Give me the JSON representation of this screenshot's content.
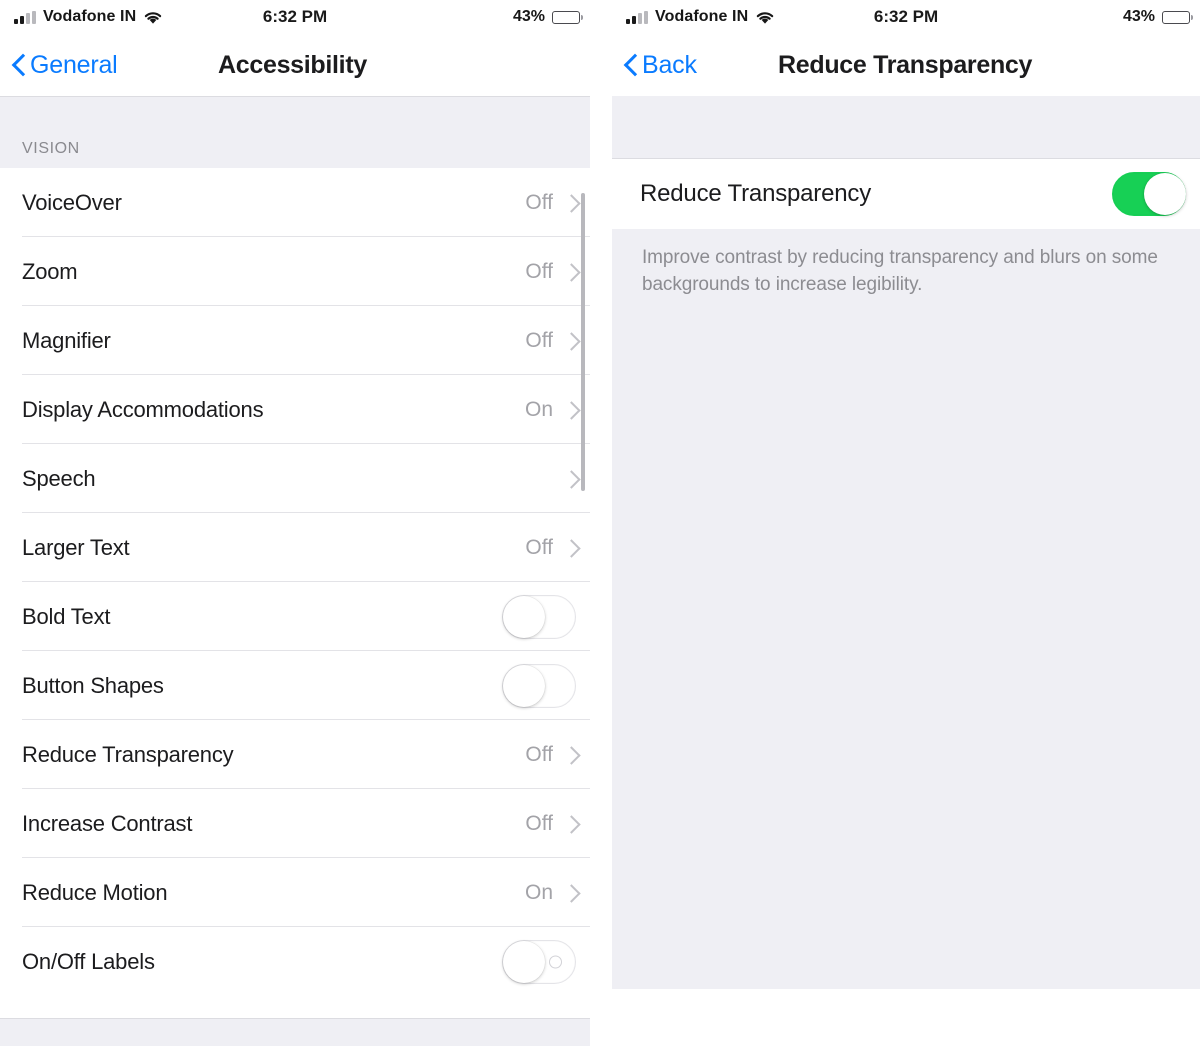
{
  "status_bar": {
    "carrier": "Vodafone IN",
    "wifi_icon": "wifi-icon",
    "time": "6:32 PM",
    "battery_percent": "43%",
    "battery_level": 43,
    "signal_bars_total": 4,
    "signal_bars_filled": 2
  },
  "left_screen": {
    "nav": {
      "back_label": "General",
      "back_icon": "chevron-left-icon",
      "title": "Accessibility"
    },
    "section_header": "VISION",
    "rows": [
      {
        "label": "VoiceOver",
        "value": "Off",
        "type": "disclosure"
      },
      {
        "label": "Zoom",
        "value": "Off",
        "type": "disclosure"
      },
      {
        "label": "Magnifier",
        "value": "Off",
        "type": "disclosure"
      },
      {
        "label": "Display Accommodations",
        "value": "On",
        "type": "disclosure"
      },
      {
        "label": "Speech",
        "value": "",
        "type": "disclosure"
      },
      {
        "label": "Larger Text",
        "value": "Off",
        "type": "disclosure"
      },
      {
        "label": "Bold Text",
        "value": "",
        "type": "switch",
        "switch_on": false,
        "off_label_mark": false
      },
      {
        "label": "Button Shapes",
        "value": "",
        "type": "switch",
        "switch_on": false,
        "off_label_mark": false
      },
      {
        "label": "Reduce Transparency",
        "value": "Off",
        "type": "disclosure"
      },
      {
        "label": "Increase Contrast",
        "value": "Off",
        "type": "disclosure"
      },
      {
        "label": "Reduce Motion",
        "value": "On",
        "type": "disclosure"
      },
      {
        "label": "On/Off Labels",
        "value": "",
        "type": "switch",
        "switch_on": false,
        "off_label_mark": true
      }
    ]
  },
  "right_screen": {
    "nav": {
      "back_label": "Back",
      "back_icon": "chevron-left-icon",
      "title": "Reduce Transparency"
    },
    "toggle_row": {
      "label": "Reduce Transparency",
      "switch_on": true
    },
    "footnote": "Improve contrast by reducing transparency and blurs on some backgrounds to increase legibility."
  },
  "colors": {
    "accent_blue": "#0a7bff",
    "switch_on_green": "#17d055",
    "group_background": "#efeff4",
    "separator": "#e3e3e7",
    "secondary_text": "#a3a3a8"
  }
}
